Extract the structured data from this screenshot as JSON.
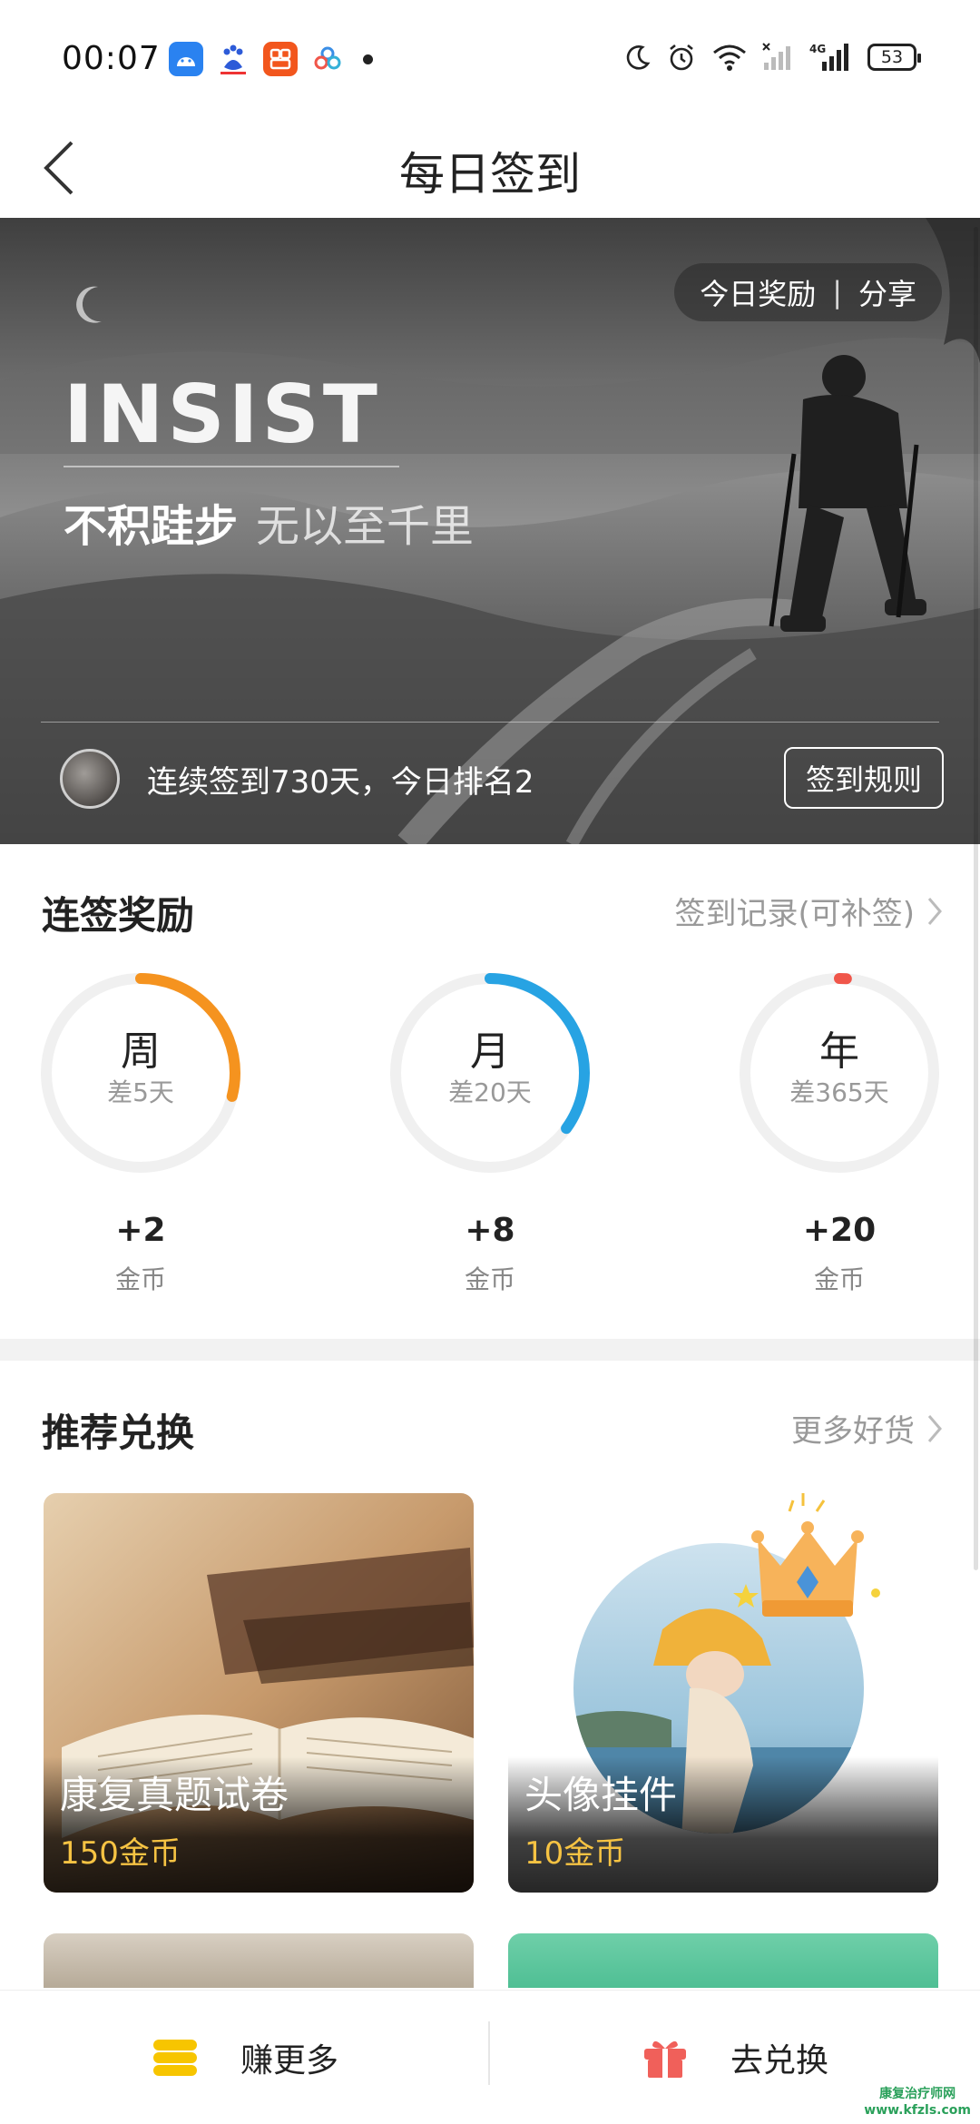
{
  "status_bar": {
    "time": "00:07",
    "battery": "53",
    "network": "4G",
    "icons": [
      "android-app-icon",
      "baidu-icon",
      "orange-app-icon",
      "cloud-app-icon",
      "moon-icon",
      "alarm-icon",
      "wifi-icon",
      "signal-icon"
    ]
  },
  "header": {
    "title": "每日签到",
    "back_icon": "chevron-left-icon"
  },
  "hero": {
    "reward_label": "今日奖励",
    "separator": "|",
    "share_label": "分享",
    "headline": "INSIST",
    "slogan_bold": "不积跬步",
    "slogan_light": "无以至千里",
    "streak_text": "连续签到730天，今日排名2",
    "rules_button": "签到规则"
  },
  "streak_rewards": {
    "title": "连签奖励",
    "record_link": "签到记录(可补签)",
    "items": [
      {
        "label": "周",
        "sub": "差5天",
        "amount": "+2",
        "unit": "金币",
        "progress": 0.29,
        "color": "#f5931f"
      },
      {
        "label": "月",
        "sub": "差20天",
        "amount": "+8",
        "unit": "金币",
        "progress": 0.35,
        "color": "#27a3e3"
      },
      {
        "label": "年",
        "sub": "差365天",
        "amount": "+20",
        "unit": "金币",
        "progress": 0.0,
        "color": "#f0564a"
      }
    ]
  },
  "exchange": {
    "title": "推荐兑换",
    "more_link": "更多好货",
    "cards": [
      {
        "name": "康复真题试卷",
        "price": "150金币"
      },
      {
        "name": "头像挂件",
        "price": "10金币"
      }
    ]
  },
  "bottom_bar": {
    "earn_label": "赚更多",
    "redeem_label": "去兑换"
  },
  "watermark": {
    "line1": "康复治疗师网",
    "line2": "www.kfzls.com"
  },
  "colors": {
    "accent_gold": "#f6c343",
    "coin_yellow": "#f7c500",
    "gift_red": "#f0605a"
  }
}
